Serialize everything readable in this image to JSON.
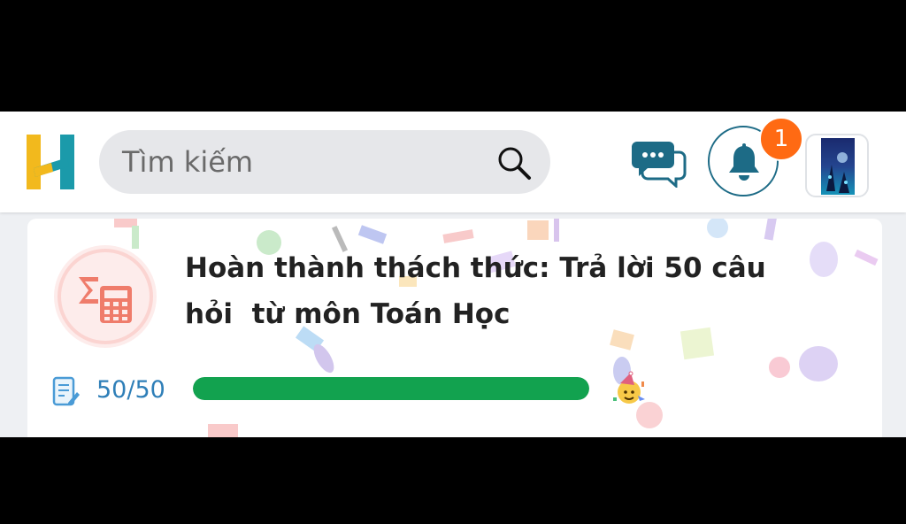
{
  "app": {
    "logo": "H",
    "colors": {
      "logo_yellow": "#f2b91d",
      "logo_teal": "#1b9aaa",
      "accent": "#1d6b86",
      "badge": "#ff6a13",
      "progress": "#12a24f"
    }
  },
  "header": {
    "search": {
      "placeholder": "Tìm kiếm",
      "icon": "search-icon"
    },
    "chat_icon": "chat-bubbles-icon",
    "notifications": {
      "icon": "bell-icon",
      "count": "1"
    },
    "avatar": "avatar"
  },
  "challenge": {
    "icon": "calculator-sigma-icon",
    "title": "Hoàn thành thách thức: Trả lời 50 câu\nhỏi  từ môn Toán Học",
    "progress": {
      "icon": "document-icon",
      "current": 50,
      "total": 50,
      "label": "50/50",
      "fraction": 1.0
    },
    "celebrate_icon": "party-popper-icon"
  }
}
